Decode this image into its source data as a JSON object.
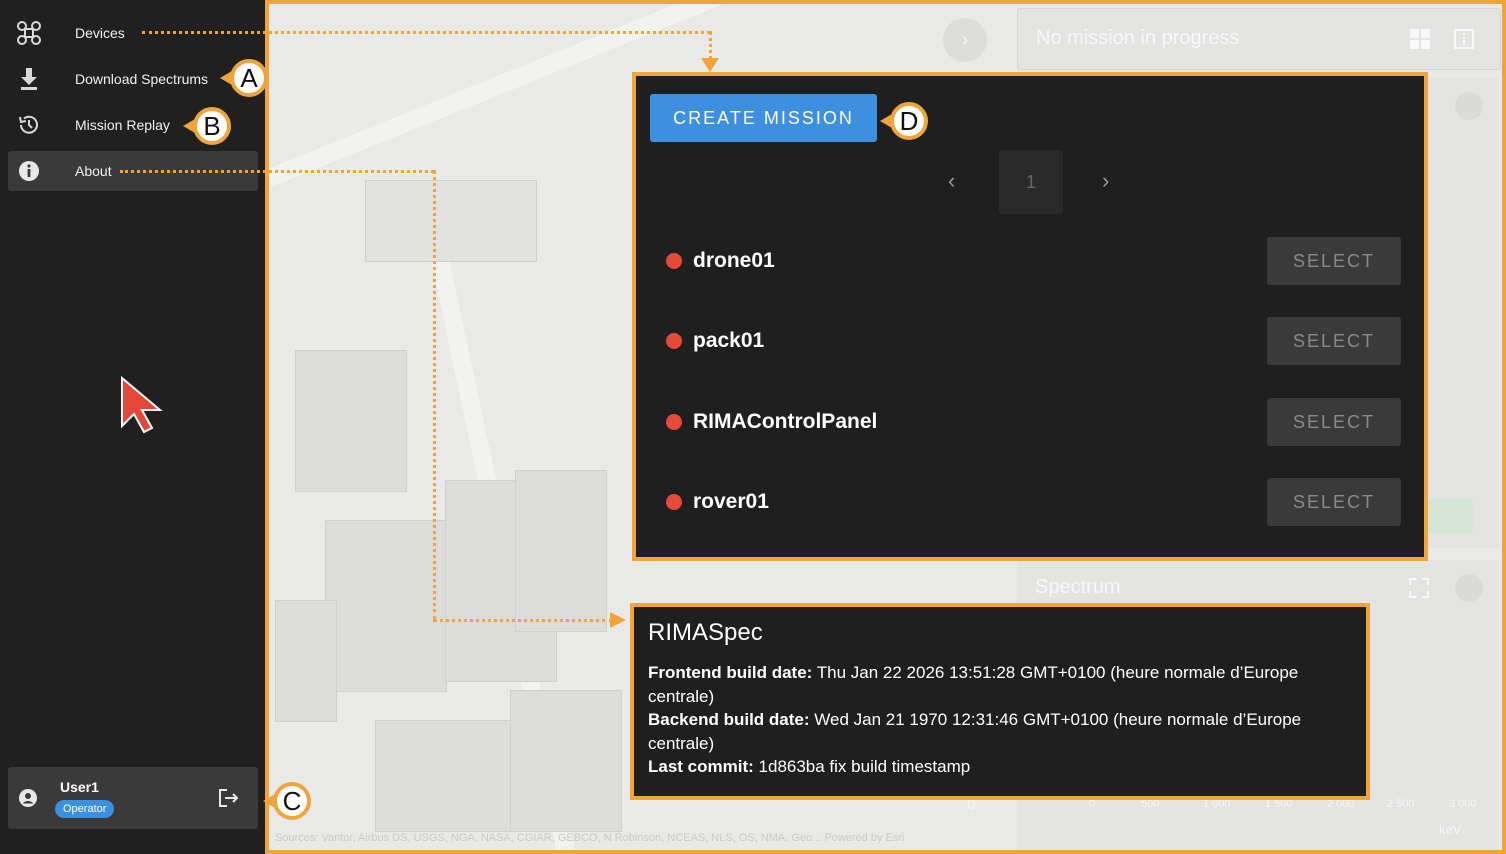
{
  "sidebar": {
    "items": [
      {
        "label": "Devices",
        "icon": "drone-icon"
      },
      {
        "label": "Download Spectrums",
        "icon": "download-icon"
      },
      {
        "label": "Mission Replay",
        "icon": "history-icon"
      },
      {
        "label": "About",
        "icon": "info-icon"
      }
    ],
    "active_item": "About",
    "user": {
      "name": "User1",
      "role": "Operator"
    }
  },
  "map": {
    "credits": "Sources: Vantor, Airbus DS, USGS, NGA, NASA, CGIAR, GEBCO, N Robinson, NCEAS, NLS, OS, NMA, Geo...    Powered by Esri"
  },
  "mission_bar": {
    "status": "No mission in progress"
  },
  "devices_popup": {
    "create_label": "CREATE MISSION",
    "page": "1",
    "select_label": "SELECT",
    "devices": [
      {
        "name": "drone01",
        "status_color": "#e24b3a"
      },
      {
        "name": "pack01",
        "status_color": "#e24b3a"
      },
      {
        "name": "RIMAControlPanel",
        "status_color": "#e24b3a"
      },
      {
        "name": "rover01",
        "status_color": "#e24b3a"
      }
    ]
  },
  "spectrum": {
    "title": "Spectrum",
    "x_ticks": [
      "0",
      "500",
      "1 000",
      "1 500",
      "2 000",
      "2 500",
      "3 000"
    ],
    "x_unit": "keV",
    "y_tick": "0"
  },
  "about": {
    "title": "RIMASpec",
    "frontend_label": "Frontend build date:",
    "frontend_value": "Thu Jan 22 2026 13:51:28 GMT+0100 (heure normale d’Europe centrale)",
    "backend_label": "Backend build date:",
    "backend_value": "Wed Jan 21 1970 12:31:46 GMT+0100 (heure normale d’Europe centrale)",
    "commit_label": "Last commit:",
    "commit_value": "1d863ba fix build timestamp"
  },
  "callouts": {
    "a": "A",
    "b": "B",
    "c": "C",
    "d": "D"
  },
  "colors": {
    "accent": "#f0a53a",
    "primary": "#3d8fe0",
    "offline": "#e24b3a"
  }
}
